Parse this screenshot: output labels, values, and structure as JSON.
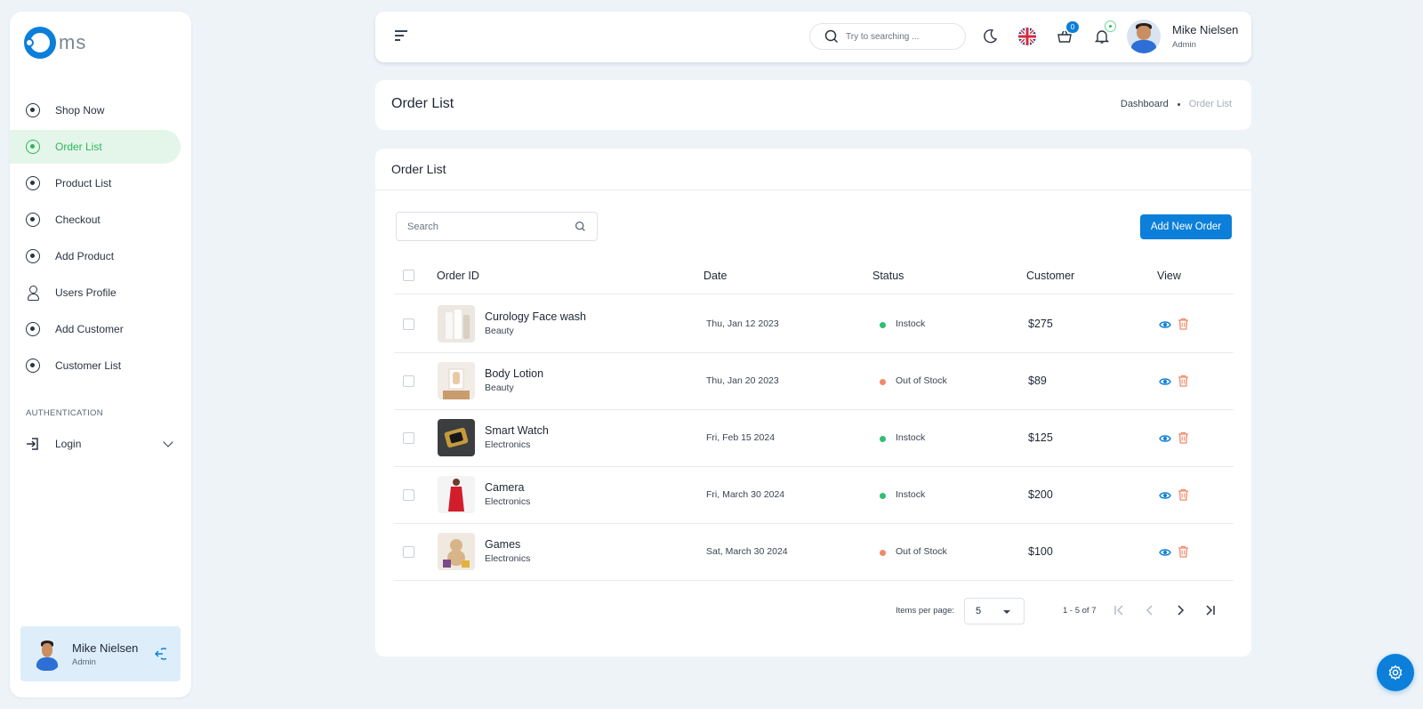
{
  "brand": {
    "logo_text": "ms"
  },
  "sidebar": {
    "items": [
      {
        "label": "Shop Now",
        "icon": "circle-dot-icon",
        "active": false
      },
      {
        "label": "Order List",
        "icon": "circle-dot-icon",
        "active": true
      },
      {
        "label": "Product List",
        "icon": "circle-dot-icon",
        "active": false
      },
      {
        "label": "Checkout",
        "icon": "circle-dot-icon",
        "active": false
      },
      {
        "label": "Add Product",
        "icon": "circle-dot-icon",
        "active": false
      },
      {
        "label": "Users Profile",
        "icon": "user-icon",
        "active": false
      },
      {
        "label": "Add Customer",
        "icon": "circle-dot-icon",
        "active": false
      },
      {
        "label": "Customer List",
        "icon": "circle-dot-icon",
        "active": false
      }
    ],
    "section_title": "AUTHENTICATION",
    "login_label": "Login",
    "user": {
      "name": "Mike Nielsen",
      "role": "Admin"
    }
  },
  "header": {
    "search_placeholder": "Try to searching ...",
    "cart_count": "0",
    "user": {
      "name": "Mike Nielsen",
      "role": "Admin"
    }
  },
  "page": {
    "title": "Order List",
    "breadcrumb": {
      "home": "Dashboard",
      "current": "Order List"
    }
  },
  "orders_card": {
    "title": "Order List",
    "search_placeholder": "Search",
    "add_button": "Add New Order",
    "columns": {
      "order_id": "Order ID",
      "date": "Date",
      "status": "Status",
      "customer": "Customer",
      "view": "View"
    },
    "rows": [
      {
        "name": "Curology Face wash",
        "category": "Beauty",
        "date": "Thu, Jan 12 2023",
        "status": "Instock",
        "status_color": "#2fbf71",
        "price": "$275"
      },
      {
        "name": "Body Lotion",
        "category": "Beauty",
        "date": "Thu, Jan 20 2023",
        "status": "Out of Stock",
        "status_color": "#ef8a6a",
        "price": "$89"
      },
      {
        "name": "Smart Watch",
        "category": "Electronics",
        "date": "Fri, Feb 15 2024",
        "status": "Instock",
        "status_color": "#2fbf71",
        "price": "$125"
      },
      {
        "name": "Camera",
        "category": "Electronics",
        "date": "Fri, March 30 2024",
        "status": "Instock",
        "status_color": "#2fbf71",
        "price": "$200"
      },
      {
        "name": "Games",
        "category": "Electronics",
        "date": "Sat, March 30 2024",
        "status": "Out of Stock",
        "status_color": "#ef8a6a",
        "price": "$100"
      }
    ],
    "pagination": {
      "items_per_page_label": "Items per page:",
      "items_per_page_value": "5",
      "range": "1 - 5 of 7"
    }
  },
  "colors": {
    "accent": "#0b7fd9",
    "active_green": "#2fb55a",
    "active_bg": "#e4f6ea",
    "danger": "#ef8a6a"
  }
}
